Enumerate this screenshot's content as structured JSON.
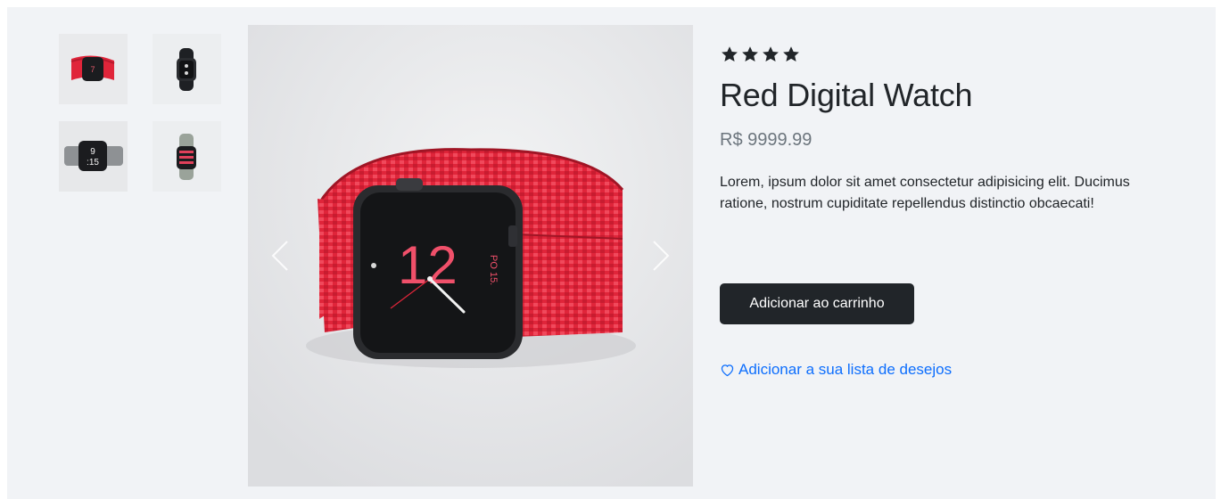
{
  "product": {
    "rating_stars": 4,
    "title": "Red Digital Watch",
    "price": "R$ 9999.99",
    "description": "Lorem, ipsum dolor sit amet consectetur adipisicing elit. Ducimus ratione, nostrum cupiditate repellendus distinctio obcaecati!",
    "main_image": {
      "icon": "red-watch-image",
      "band_color": "#e0253a",
      "face_color": "#1b1c1f",
      "dial_text": "12",
      "dial_date": "PO 15"
    }
  },
  "gallery": {
    "thumbnails": [
      {
        "icon": "red-watch-thumbnail",
        "band_color": "#e0253a"
      },
      {
        "icon": "black-watch-thumbnail",
        "band_color": "#1e2024"
      },
      {
        "icon": "gray-watch-thumbnail",
        "band_color": "#8e9194",
        "dial_text": "9:15"
      },
      {
        "icon": "pink-watch-thumbnail",
        "band_color": "#9aa39a"
      }
    ],
    "prev_icon": "chevron-left-icon",
    "next_icon": "chevron-right-icon"
  },
  "actions": {
    "add_to_cart_label": "Adicionar ao carrinho",
    "wishlist_label": "Adicionar a sua lista de desejos",
    "wishlist_icon": "heart-outline-icon"
  },
  "colors": {
    "accent_dark": "#212529",
    "link_blue": "#0d6efd",
    "muted_gray": "#6c757d",
    "panel_bg": "#f1f3f6"
  }
}
